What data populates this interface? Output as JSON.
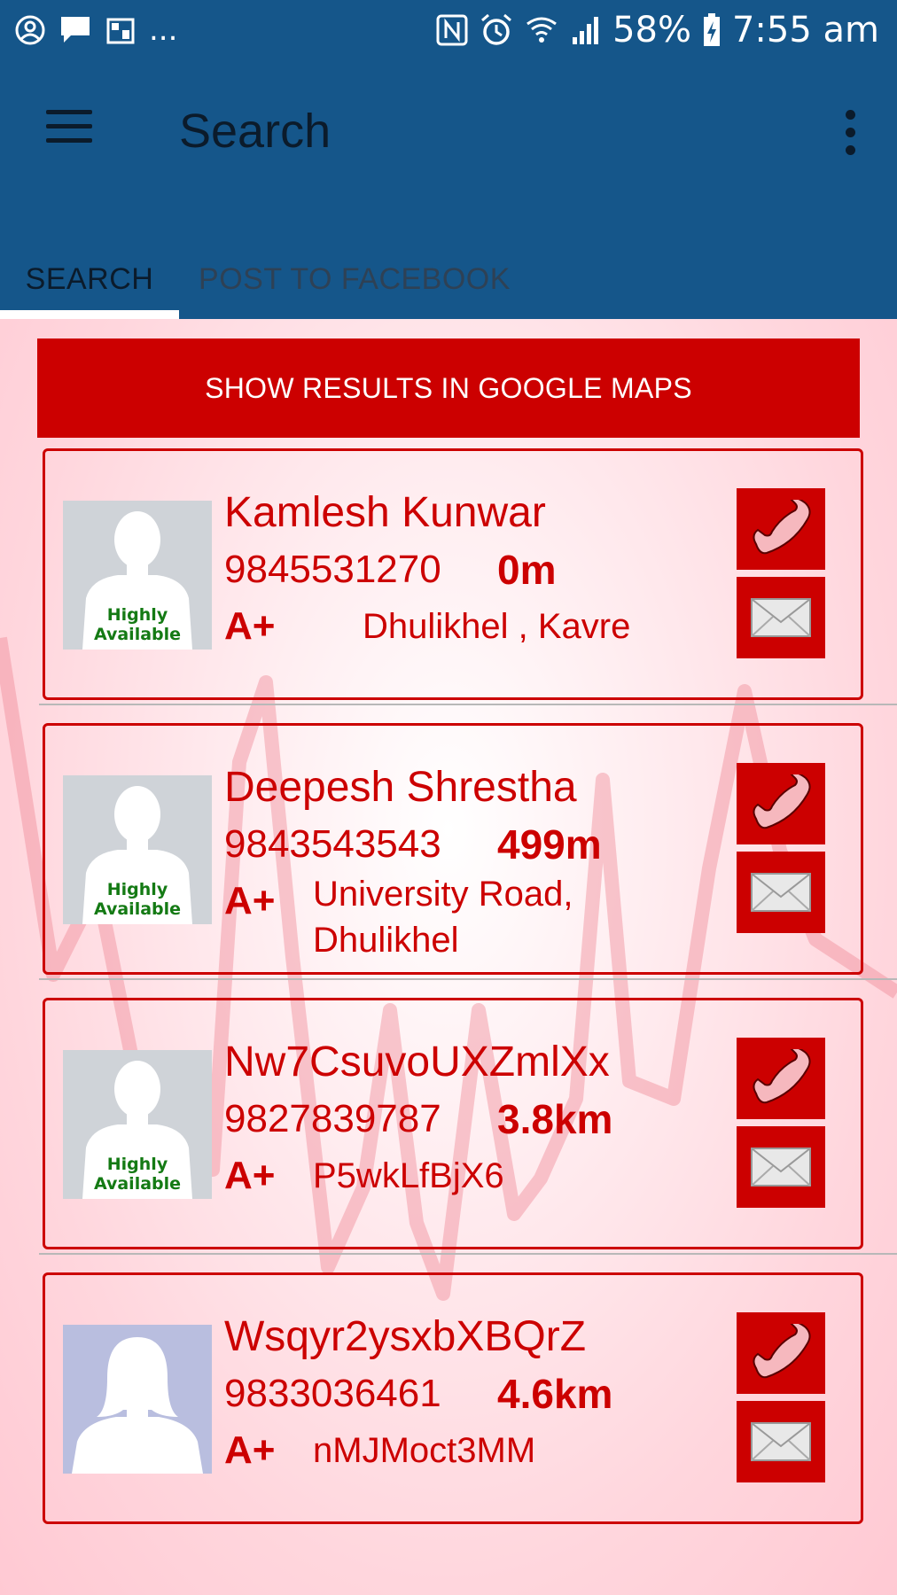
{
  "status_bar": {
    "left_icons": [
      "account-circle-icon",
      "chat-bubble-icon",
      "gallery-icon"
    ],
    "more": "...",
    "right_icons": [
      "nfc-icon",
      "alarm-icon",
      "wifi-icon",
      "signal-icon",
      "battery-charging-icon"
    ],
    "battery": "58%",
    "time": "7:55 am"
  },
  "toolbar": {
    "title": "Search",
    "menu_icon": "hamburger-menu-icon",
    "overflow_icon": "more-vert-icon"
  },
  "tabs": [
    {
      "label": "SEARCH",
      "active": true
    },
    {
      "label": "POST TO FACEBOOK",
      "active": false
    }
  ],
  "colors": {
    "primary": "#15568a",
    "accent": "#cc0000",
    "available": "#147a14"
  },
  "maps_button": {
    "label": "SHOW RESULTS IN GOOGLE MAPS"
  },
  "donors": [
    {
      "name": "Kamlesh Kunwar",
      "phone": "9845531270",
      "distance": "0m",
      "blood_group": "A+",
      "address": "Dhulikhel , Kavre",
      "availability": "Highly Available",
      "avatar": "male-avatar-icon"
    },
    {
      "name": "Deepesh Shrestha",
      "phone": "9843543543",
      "distance": "499m",
      "blood_group": "A+",
      "address": "University Road, Dhulikhel",
      "availability": "Highly Available",
      "avatar": "male-avatar-icon"
    },
    {
      "name": "Nw7CsuvoUXZmlXx",
      "phone": "9827839787",
      "distance": "3.8km",
      "blood_group": "A+",
      "address": "P5wkLfBjX6",
      "availability": "Highly Available",
      "avatar": "male-avatar-icon"
    },
    {
      "name": "Wsqyr2ysxbXBQrZ",
      "phone": "9833036461",
      "distance": "4.6km",
      "blood_group": "A+",
      "address": "nMJMoct3MM",
      "availability": "",
      "avatar": "female-avatar-icon"
    }
  ]
}
